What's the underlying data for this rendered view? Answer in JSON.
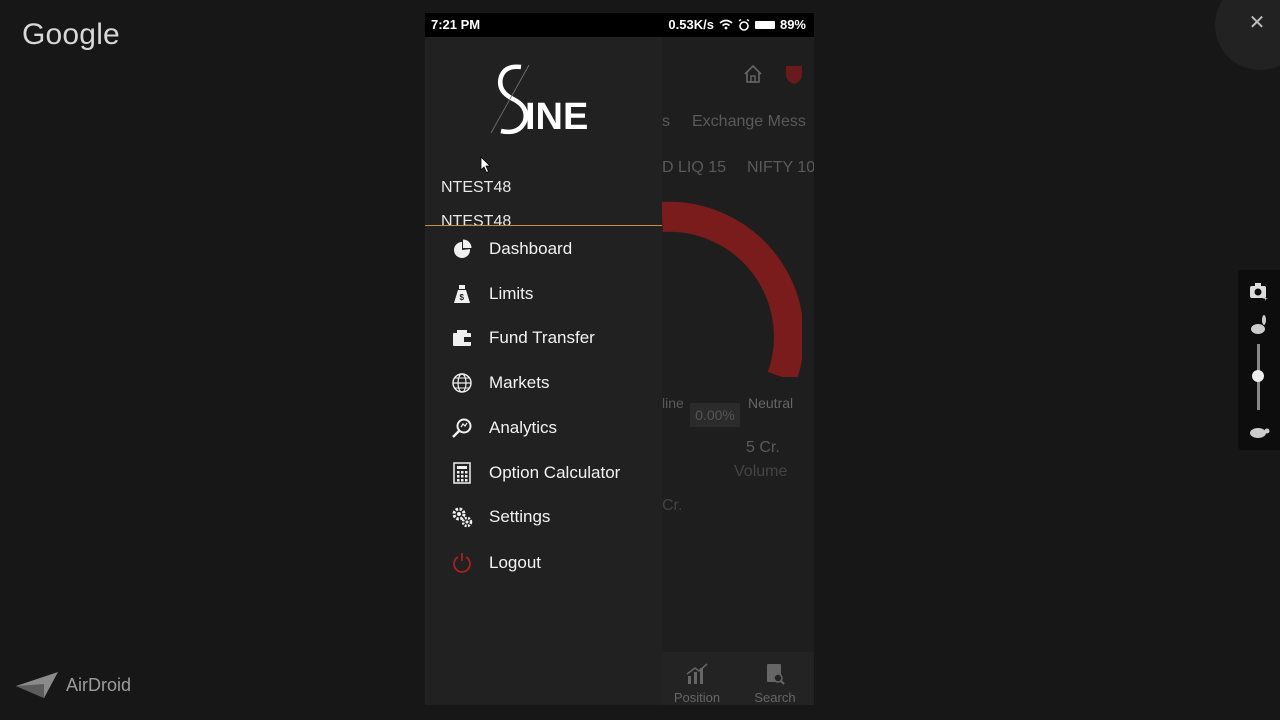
{
  "google": {
    "label": "Google"
  },
  "airdroid": {
    "label": "AirDroid"
  },
  "status_bar": {
    "time": "7:21 PM",
    "net_speed": "0.53K/s",
    "battery": "89%"
  },
  "drawer": {
    "user_line1": "NTEST48",
    "user_line2": "NTEST48",
    "items": [
      {
        "label": "Dashboard",
        "icon": "pie-chart-icon"
      },
      {
        "label": "Limits",
        "icon": "money-bag-icon"
      },
      {
        "label": "Fund Transfer",
        "icon": "wallet-icon"
      },
      {
        "label": "Markets",
        "icon": "globe-icon"
      },
      {
        "label": "Analytics",
        "icon": "magnifier-icon"
      },
      {
        "label": "Option Calculator",
        "icon": "calculator-icon"
      },
      {
        "label": "Settings",
        "icon": "gears-icon"
      },
      {
        "label": "Logout",
        "icon": "power-icon"
      }
    ]
  },
  "background_app": {
    "tab_label": "Exchange Mess",
    "tab_partial": "s",
    "ticker_1": "D LIQ 15",
    "ticker_2": "NIFTY 10",
    "decline_label": "line",
    "percent": "0.00%",
    "neutral_label": "Neutral",
    "volume_value": "5 Cr.",
    "volume_label": "Volume",
    "left_value": "Cr.",
    "bottom_tabs": [
      {
        "label": "Position"
      },
      {
        "label": "Search"
      }
    ]
  },
  "colors": {
    "accent": "#c98a4a",
    "gauge": "#7a1c1c",
    "logout": "#b32020"
  }
}
